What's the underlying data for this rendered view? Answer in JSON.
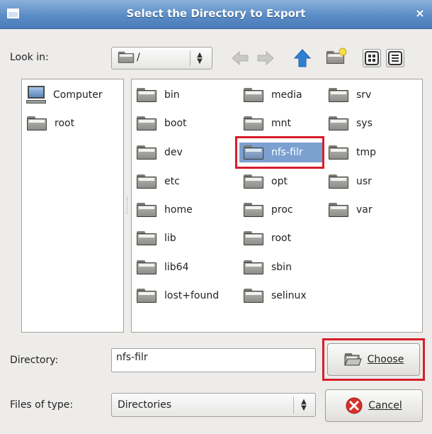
{
  "window": {
    "title": "Select the Directory to Export",
    "close_glyph": "×"
  },
  "lookin": {
    "label": "Look in:",
    "path": "/"
  },
  "toolbar": {
    "icons": [
      "back-arrow-icon",
      "forward-arrow-icon",
      "up-arrow-icon",
      "new-folder-icon",
      "icon-view-icon",
      "list-view-icon"
    ]
  },
  "places": [
    {
      "label": "Computer",
      "icon": "computer-icon"
    },
    {
      "label": "root",
      "icon": "folder-icon"
    }
  ],
  "files": {
    "col1": [
      "bin",
      "boot",
      "dev",
      "etc",
      "home",
      "lib",
      "lib64",
      "lost+found"
    ],
    "col2": [
      "media",
      "mnt",
      "nfs-filr",
      "opt",
      "proc",
      "root",
      "sbin",
      "selinux"
    ],
    "col3": [
      "srv",
      "sys",
      "tmp",
      "usr",
      "var"
    ],
    "selected": "nfs-filr"
  },
  "directory": {
    "label": "Directory:",
    "value": "nfs-filr"
  },
  "filetype": {
    "label": "Files of type:",
    "value": "Directories"
  },
  "buttons": {
    "choose": "Choose",
    "cancel": "Cancel"
  },
  "colors": {
    "title_bar": "#5b8cc6",
    "selection": "#7ca0cf",
    "highlight_box": "#d81e2a",
    "up_arrow": "#2f7fd3",
    "cancel_red": "#d9302c"
  }
}
